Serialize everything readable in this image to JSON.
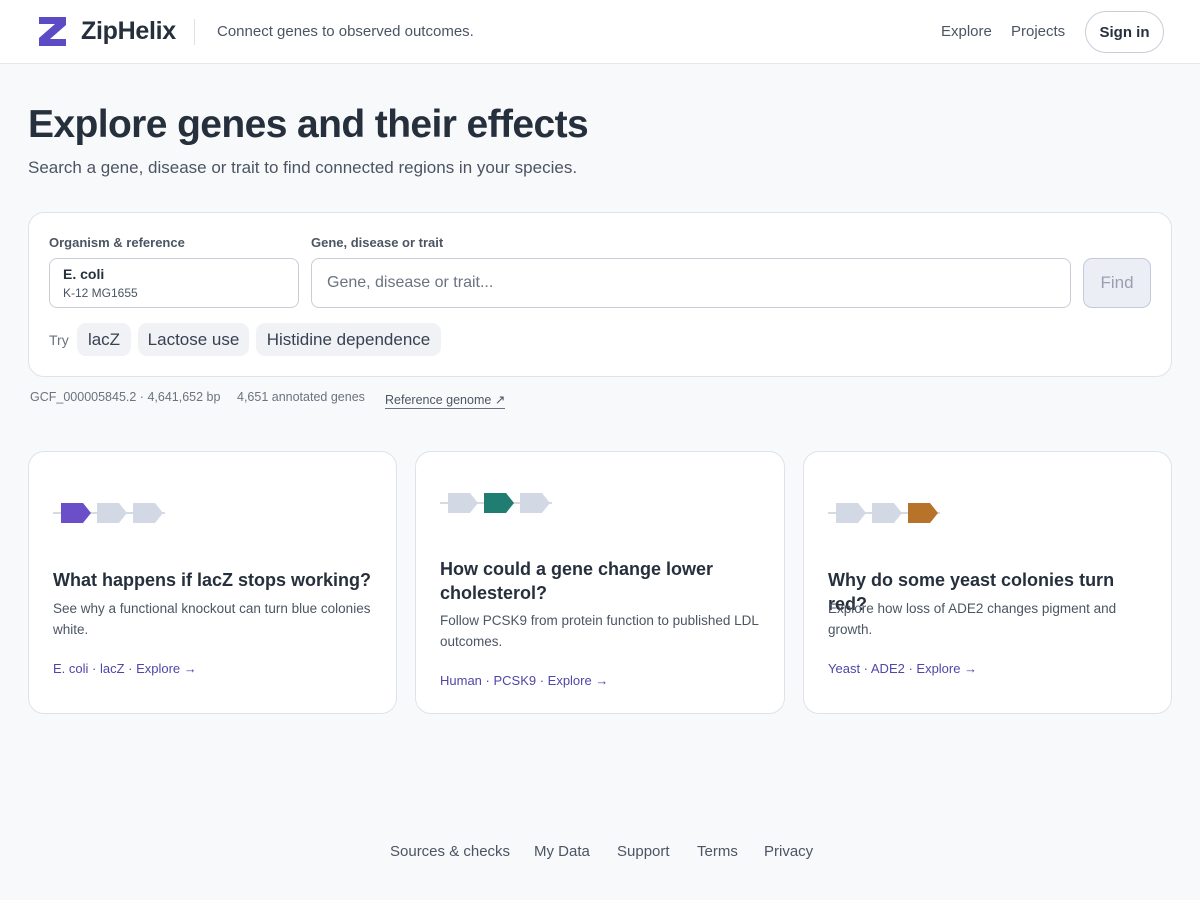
{
  "header": {
    "brand": "ZipHelix",
    "tagline": "Connect genes to observed outcomes.",
    "nav": {
      "explore": "Explore",
      "projects": "Projects"
    },
    "sign_in": "Sign in",
    "logo_icon": "z-logo-icon",
    "brand_color": "#5b4bc4"
  },
  "hero": {
    "title": "Explore genes and their effects",
    "subtitle": "Search a gene, disease or trait to find connected regions in your species."
  },
  "search": {
    "organism_label": "Organism & reference",
    "organism_name": "E. coli",
    "organism_strain": "K-12 MG1655",
    "query_label": "Gene, disease or trait",
    "query_value": "",
    "query_placeholder": "Gene, disease or trait...",
    "find_label": "Find",
    "try_label": "Try",
    "suggestions": [
      "lacZ",
      "Lactose use",
      "Histidine dependence"
    ]
  },
  "reference": {
    "accession": "GCF_000005845.2 · 4,641,652 bp",
    "gene_count": "4,651 annotated genes",
    "link_label": "Reference genome ↗"
  },
  "cards": [
    {
      "title": "What happens if lacZ stops working?",
      "description": "See why a functional knockout can turn blue colonies white.",
      "link": "E. coli · lacZ · Explore →",
      "highlight_color": "#6a4fc8",
      "highlight_index": 0
    },
    {
      "title": "How could a gene change lower cholesterol?",
      "description": "Follow PCSK9 from protein function to published LDL outcomes.",
      "link": "Human · PCSK9 · Explore →",
      "highlight_color": "#1f7d72",
      "highlight_index": 1
    },
    {
      "title": "Why do some yeast colonies turn red?",
      "description": "Explore how loss of ADE2 changes pigment and growth.",
      "link": "Yeast · ADE2 · Explore →",
      "highlight_color": "#b8732a",
      "highlight_index": 2
    }
  ],
  "footer": {
    "links": [
      "Sources & checks",
      "My Data",
      "Support",
      "Terms",
      "Privacy"
    ]
  }
}
